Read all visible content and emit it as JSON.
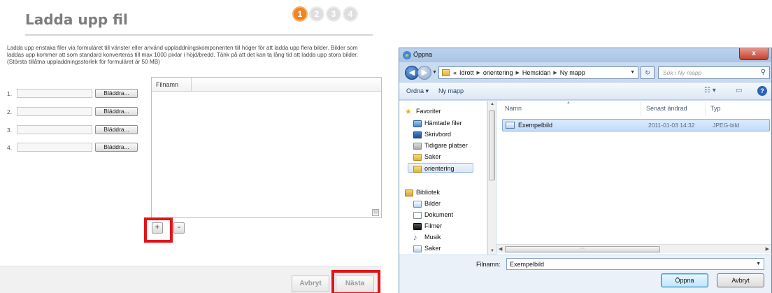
{
  "upload": {
    "title": "Ladda upp fil",
    "steps": [
      "1",
      "2",
      "3",
      "4"
    ],
    "description": "Ladda upp enstaka filer via formuläret till vänster eller använd uppladdningskomponenten till höger för att ladda upp flera bilder. Bilder som laddas upp kommer att som standard konverteras till max 1000 pixlar i höjd/bredd. Tänk på att det kan ta lång tid att ladda upp stora bilder.  (Största tillåtna uppladdningsstorlek för formuläret är 50 MB)",
    "file_rows": [
      {
        "num": "1.",
        "browse": "Bläddra..."
      },
      {
        "num": "2.",
        "browse": "Bläddra..."
      },
      {
        "num": "3.",
        "browse": "Bläddra..."
      },
      {
        "num": "4.",
        "browse": "Bläddra..."
      }
    ],
    "filelist_header": "Filnamn",
    "add_button": "+",
    "remove_button": "-",
    "cancel_button": "Avbryt",
    "next_button": "Nästa",
    "accent_color": "#f08422",
    "highlight_color": "#e1141b"
  },
  "dialog": {
    "title": "Öppna",
    "close": "x",
    "breadcrumb_prefix": "«",
    "breadcrumb": [
      "Idrott",
      "orientering",
      "Hemsidan",
      "Ny mapp"
    ],
    "search_placeholder": "Sök i Ny mapp",
    "toolbar": {
      "organize": "Ordna ▾",
      "new_folder": "Ny mapp"
    },
    "nav": {
      "favorites_label": "Favoriter",
      "favorites": [
        "Hämtade filer",
        "Skrivbord",
        "Tidigare platser",
        "Saker",
        "orientering"
      ],
      "selected_favorite": "orientering",
      "libraries_label": "Bibliotek",
      "libraries": [
        "Bilder",
        "Dokument",
        "Filmer",
        "Musik",
        "Saker"
      ]
    },
    "columns": {
      "name": "Namn",
      "modified": "Senast ändrad",
      "type": "Typ"
    },
    "files": [
      {
        "name": "Exempelbild",
        "modified": "2011-01-03 14:32",
        "type": "JPEG-bild"
      }
    ],
    "filename_label": "Filnamn:",
    "filename_value": "Exempelbild",
    "open_button": "Öppna",
    "cancel_button": "Avbryt"
  }
}
